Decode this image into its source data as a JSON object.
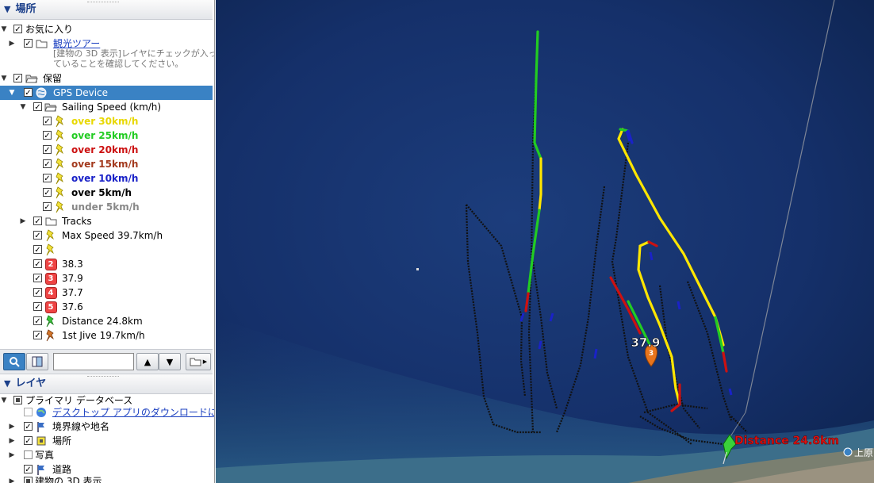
{
  "places_panel": {
    "title": "場所",
    "favorites": {
      "label": "お気に入り"
    },
    "sightseeing": {
      "label": "観光ツアー",
      "note_line1": "[建物の 3D 表示]レイヤにチェックが入っ",
      "note_line2": "ていることを確認してください。"
    },
    "temporary": {
      "label": "保留"
    },
    "gps_device": {
      "label": "GPS Device"
    },
    "sailing_speed": {
      "label": "Sailing Speed (km/h)"
    },
    "speed_bands": [
      {
        "label": "over 30km/h",
        "color": "#ffe600"
      },
      {
        "label": "over 25km/h",
        "color": "#22cc22"
      },
      {
        "label": "over 20km/h",
        "color": "#cc1111"
      },
      {
        "label": "over 15km/h",
        "color": "#a33a1e"
      },
      {
        "label": "over 10km/h",
        "color": "#1a22c8"
      },
      {
        "label": "over 5km/h",
        "color": "#000000"
      },
      {
        "label": "under 5km/h",
        "color": "#888888"
      }
    ],
    "tracks": {
      "label": "Tracks"
    },
    "max_speed": {
      "label": "Max Speed 39.7km/h"
    },
    "ranked": [
      {
        "num": "2",
        "label": "38.3"
      },
      {
        "num": "3",
        "label": "37.9"
      },
      {
        "num": "4",
        "label": "37.7"
      },
      {
        "num": "5",
        "label": "37.6"
      }
    ],
    "distance": {
      "label": "Distance 24.8km"
    },
    "first_jive": {
      "label": "1st Jive 19.7km/h"
    }
  },
  "toolbar": {
    "search_value": ""
  },
  "layers_panel": {
    "title": "レイヤ",
    "primary_db": {
      "label": "プライマリ データベース"
    },
    "desktop_link": {
      "label": "デスクトップ アプリのダウンロードに関する"
    },
    "borders": {
      "label": "境界線や地名"
    },
    "places": {
      "label": "場所"
    },
    "photos": {
      "label": "写真"
    },
    "roads": {
      "label": "道路"
    },
    "buildings": {
      "label": "建物の 3D 表示"
    }
  },
  "map": {
    "marker_label": "37.9",
    "marker_num": "3",
    "distance_label": "Distance 24.8km",
    "coast_label": "上原"
  }
}
